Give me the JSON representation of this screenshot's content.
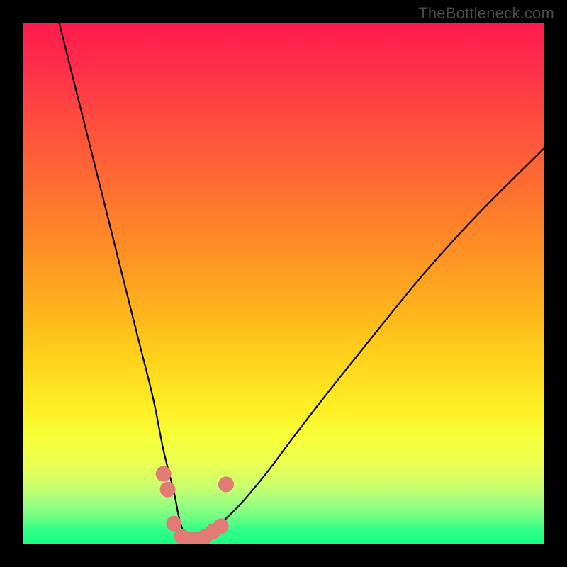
{
  "watermark": "TheBottleneck.com",
  "chart_data": {
    "type": "line",
    "title": "",
    "xlabel": "",
    "ylabel": "",
    "xlim": [
      0,
      100
    ],
    "ylim": [
      0,
      100
    ],
    "grid": false,
    "legend": false,
    "series": [
      {
        "name": "bottleneck-curve",
        "x": [
          7,
          10,
          13,
          16,
          19,
          22,
          25,
          27,
          29,
          30,
          31,
          32,
          34,
          36,
          38,
          42,
          47,
          53,
          60,
          68,
          77,
          87,
          98,
          100
        ],
        "y": [
          100,
          88,
          76,
          64,
          52,
          40,
          28,
          18,
          10,
          5,
          2,
          1,
          1,
          2,
          4,
          8,
          14,
          22,
          31,
          41,
          52,
          63,
          74,
          76
        ]
      }
    ],
    "markers": {
      "name": "highlighted-points",
      "color": "#e27a76",
      "points": [
        {
          "x": 27.0,
          "y": 13.5
        },
        {
          "x": 27.8,
          "y": 10.5
        },
        {
          "x": 29.0,
          "y": 4.0
        },
        {
          "x": 30.5,
          "y": 1.5
        },
        {
          "x": 32.0,
          "y": 1.0
        },
        {
          "x": 33.5,
          "y": 1.0
        },
        {
          "x": 35.0,
          "y": 1.5
        },
        {
          "x": 36.5,
          "y": 2.5
        },
        {
          "x": 38.0,
          "y": 3.5
        },
        {
          "x": 39.0,
          "y": 11.5
        }
      ]
    },
    "background_gradient": {
      "top": "#ff1a4d",
      "mid": "#ffe11a",
      "bottom": "#18ff83"
    }
  }
}
